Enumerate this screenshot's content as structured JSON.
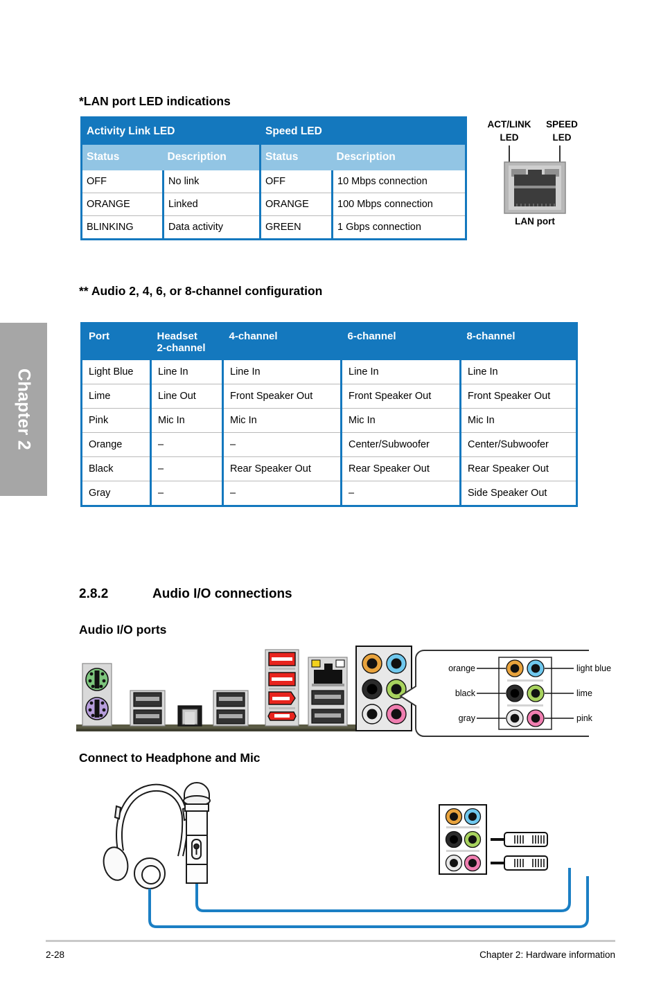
{
  "chapter_tab": {
    "label": "Chapter 2"
  },
  "lan_section": {
    "heading": "*LAN port LED indications",
    "table": {
      "group_headers": [
        "Activity Link LED",
        "Speed LED"
      ],
      "sub_headers": [
        "Status",
        "Description",
        "Status",
        "Description"
      ],
      "rows": [
        [
          "OFF",
          "No link",
          "OFF",
          "10 Mbps connection"
        ],
        [
          "ORANGE",
          "Linked",
          "ORANGE",
          "100 Mbps connection"
        ],
        [
          "BLINKING",
          "Data activity",
          "GREEN",
          "1 Gbps connection"
        ]
      ]
    },
    "figure": {
      "label_act": "ACT/LINK",
      "label_act2": "LED",
      "label_speed": "SPEED",
      "label_speed2": "LED",
      "caption": "LAN port"
    }
  },
  "audio_section": {
    "heading": "** Audio 2, 4, 6, or 8-channel configuration",
    "table": {
      "headers": [
        "Port",
        "Headset\n2-channel",
        "4-channel",
        "6-channel",
        "8-channel"
      ],
      "rows": [
        [
          "Light Blue",
          "Line In",
          "Line In",
          "Line In",
          "Line In"
        ],
        [
          "Lime",
          "Line Out",
          "Front Speaker Out",
          "Front Speaker Out",
          "Front Speaker Out"
        ],
        [
          "Pink",
          "Mic In",
          "Mic In",
          "Mic In",
          "Mic In"
        ],
        [
          "Orange",
          "–",
          "–",
          "Center/Subwoofer",
          "Center/Subwoofer"
        ],
        [
          "Black",
          "–",
          "Rear Speaker Out",
          "Rear Speaker Out",
          "Rear Speaker Out"
        ],
        [
          "Gray",
          "–",
          "–",
          "–",
          "Side Speaker Out"
        ]
      ]
    }
  },
  "io_section": {
    "number": "2.8.2",
    "title": "Audio I/O connections",
    "subtitle": "Audio I/O ports",
    "callout": {
      "left_labels": [
        "orange",
        "black",
        "gray"
      ],
      "right_labels": [
        "light blue",
        "lime",
        "pink"
      ],
      "jack_colors": {
        "orange": "#E8A33D",
        "light_blue": "#6FC8EE",
        "black": "#2B2B2B",
        "lime": "#A8D35E",
        "gray": "#E8E8E8",
        "pink": "#F07EB0"
      }
    },
    "rear_panel": {
      "ps2_keyboard_color": "#7DC67D",
      "ps2_mouse_color": "#B79EDC",
      "usb3_color": "#E8241E",
      "lan_led_act_color": "#F2D11E",
      "lan_led_speed_color": "#FFFFFF"
    }
  },
  "headphone_section": {
    "heading": "Connect to Headphone and Mic",
    "cable_color": "#1B7FC4"
  },
  "footer": {
    "page": "2-28",
    "chapter": "Chapter 2: Hardware information"
  },
  "theme": {
    "table_header_blue": "#1478BE",
    "table_subheader_blue": "#92C5E4",
    "chapter_tab_gray": "#A6A6A6"
  }
}
